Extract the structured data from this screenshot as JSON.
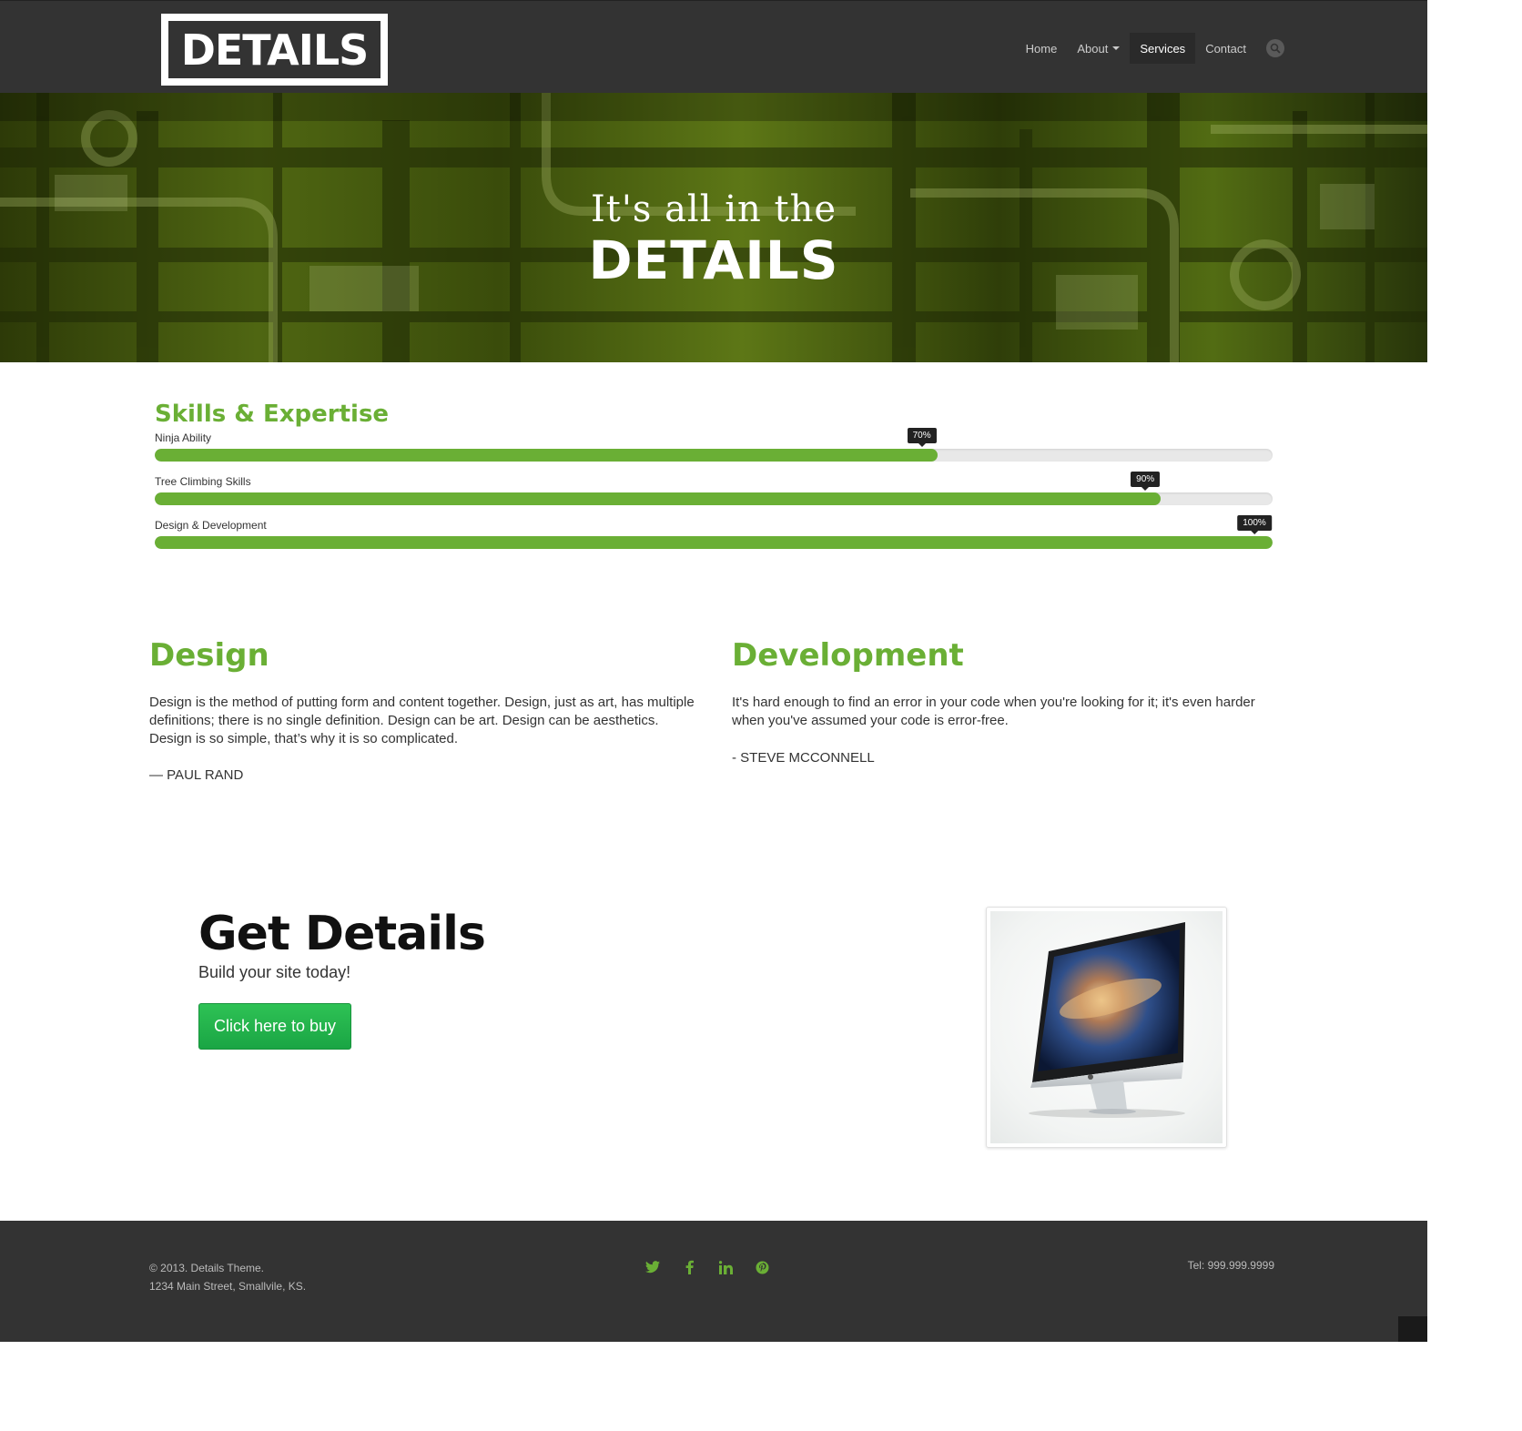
{
  "brand": {
    "logo_text": "DETAILS"
  },
  "nav": {
    "items": [
      {
        "label": "Home",
        "active": false
      },
      {
        "label": "About",
        "active": false,
        "dropdown": true
      },
      {
        "label": "Services",
        "active": true
      },
      {
        "label": "Contact",
        "active": false
      }
    ],
    "search_icon": "search-icon"
  },
  "hero": {
    "line1": "It's all in the",
    "line2": "DETAILS"
  },
  "skills": {
    "title": "Skills & Expertise",
    "items": [
      {
        "label": "Ninja Ability",
        "percent": 70,
        "tip": "70%"
      },
      {
        "label": "Tree Climbing Skills",
        "percent": 90,
        "tip": "90%"
      },
      {
        "label": "Design & Development",
        "percent": 100,
        "tip": "100%"
      }
    ]
  },
  "columns": {
    "design": {
      "title": "Design",
      "text": "Design is the method of putting form and content together. Design, just as art, has multiple definitions; there is no single definition. Design can be art. Design can be aesthetics. Design is so simple, that’s why it is so complicated.",
      "author": "— PAUL RAND"
    },
    "development": {
      "title": "Development",
      "text": "It's hard enough to find an error in your code when you're looking for it; it's even harder when you've assumed your code is error-free.",
      "author": "- STEVE MCCONNELL"
    }
  },
  "cta": {
    "title": "Get Details",
    "subtitle": "Build your site today!",
    "button": "Click here to buy"
  },
  "footer": {
    "copyright": "© 2013. Details Theme.",
    "address": "1234 Main Street, Smallvile, KS.",
    "phone": "Tel: 999.999.9999",
    "socials": [
      "twitter-icon",
      "facebook-icon",
      "linkedin-icon",
      "pinterest-icon"
    ]
  },
  "colors": {
    "accent": "#6aaf35",
    "header_bg": "#333333",
    "button": "#1fb04a"
  }
}
